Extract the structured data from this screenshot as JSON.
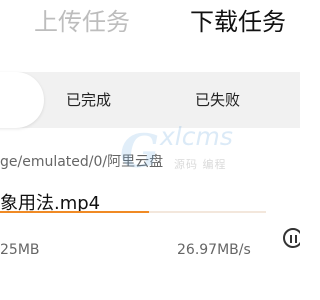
{
  "tabs": {
    "upload": "上传任务",
    "download": "下载任务"
  },
  "filters": {
    "completed": "已完成",
    "failed": "已失败"
  },
  "path": "ge/emulated/0/阿里云盘",
  "watermark": {
    "brand": "xlcms",
    "subtitle": "源码 编程"
  },
  "download_item": {
    "file_name": "象用法.mp4",
    "size": "25MB",
    "speed": "26.97MB/s",
    "progress_fraction": 0.56,
    "icon": "pause-icon"
  },
  "colors": {
    "accent": "#f08a24",
    "active_tab": "#111111",
    "inactive_tab": "#bdbdbd"
  }
}
